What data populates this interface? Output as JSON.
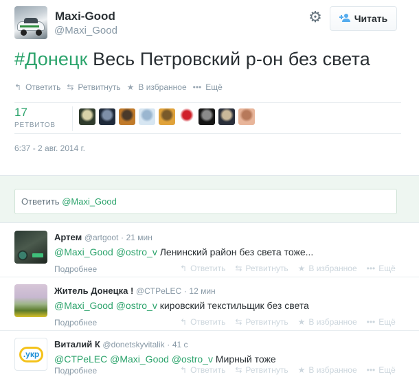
{
  "tweet": {
    "author_name": "Maxi-Good",
    "author_handle": "@Maxi_Good",
    "hashtag": "#Донецк",
    "text": " Весь Петровский р-он без света",
    "timestamp": "6:37 - 2 авг. 2014 г.",
    "retweet_count": "17",
    "retweet_label": "РЕТВИТОВ"
  },
  "header": {
    "follow_label": "Читать",
    "gear_icon": "gear-icon",
    "follow_icon": "add-user-icon"
  },
  "actions": {
    "reply": "Ответить",
    "retweet": "Ретвитнуть",
    "favorite": "В избранное",
    "more": "Ещё"
  },
  "retweeters": [
    {
      "color_a": "#2f3b2c",
      "color_b": "#d8d2a8"
    },
    {
      "color_a": "#1f2a3a",
      "color_b": "#7e8fa8"
    },
    {
      "color_a": "#c07a2a",
      "color_b": "#4a3a2a"
    },
    {
      "color_a": "#d7e6f2",
      "color_b": "#9ab6d0"
    },
    {
      "color_a": "#e0a23a",
      "color_b": "#7a5a2a"
    },
    {
      "color_a": "#ffffff",
      "color_b": "#d0202a"
    },
    {
      "color_a": "#151515",
      "color_b": "#8a8a8a"
    },
    {
      "color_a": "#2a2f3a",
      "color_b": "#c9b89a"
    },
    {
      "color_a": "#e8b59a",
      "color_b": "#b7795a"
    }
  ],
  "reply_box": {
    "prefix": "Ответить ",
    "mention": "@Maxi_Good"
  },
  "replies": [
    {
      "name": "Артем",
      "handle": "@artgoot",
      "time": "21 мин",
      "mentions": "@Maxi_Good @ostro_v",
      "text": " Ленинский район без света тоже...",
      "more": "Подробнее"
    },
    {
      "name": "Житель Донецка !",
      "handle": "@CTPeLEC",
      "time": "12 мин",
      "mentions": "@Maxi_Good @ostro_v",
      "text": " кировский текстильщик без света",
      "more": "Подробнее"
    },
    {
      "name": "Виталий К",
      "handle": "@donetskyvitalik",
      "time": "41 с",
      "mentions": "@CTPeLEC @Maxi_Good @ostro_v",
      "text": " Мирный тоже",
      "more": "Подробнее",
      "avatar_text": ".укр"
    }
  ],
  "colors": {
    "accent_green": "#2ba36b",
    "follow_blue": "#55acee",
    "muted": "#8899a6"
  }
}
